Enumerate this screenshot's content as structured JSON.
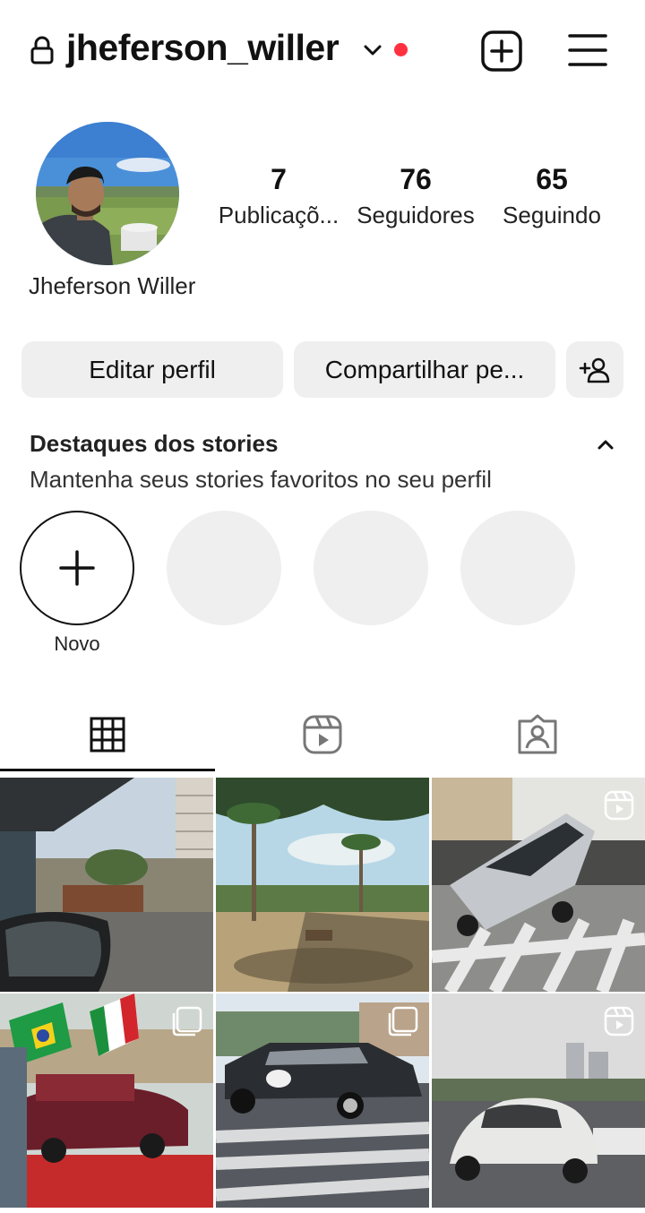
{
  "header": {
    "username": "jheferson_willer",
    "unread_dot_color": "#ff3040",
    "icons": [
      "lock-icon",
      "chevron-down-icon",
      "add-post-icon",
      "hamburger-menu-icon"
    ]
  },
  "profile": {
    "display_name": "Jheferson Willer",
    "stats": {
      "posts": {
        "value": "7",
        "label": "Publicaçõ..."
      },
      "followers": {
        "value": "76",
        "label": "Seguidores"
      },
      "following": {
        "value": "65",
        "label": "Seguindo"
      }
    }
  },
  "actions": {
    "edit_label": "Editar perfil",
    "share_label": "Compartilhar pe...",
    "discover_icon": "add-person-icon"
  },
  "highlights": {
    "title": "Destaques dos stories",
    "subtitle": "Mantenha seus stories favoritos no seu perfil",
    "new_label": "Novo"
  },
  "tabs": [
    {
      "icon": "grid-icon",
      "active": true
    },
    {
      "icon": "reels-icon",
      "active": false
    },
    {
      "icon": "tagged-icon",
      "active": false
    }
  ],
  "posts": [
    {
      "alt": "street-view-from-car",
      "badge": ""
    },
    {
      "alt": "palm-tree-plaza",
      "badge": ""
    },
    {
      "alt": "lowrider-hopping",
      "badge": "reel-icon"
    },
    {
      "alt": "lowrider-with-flags",
      "badge": "carousel-icon"
    },
    {
      "alt": "raiders-lowrider",
      "badge": "carousel-icon"
    },
    {
      "alt": "white-beetle",
      "badge": "reel-icon"
    }
  ]
}
